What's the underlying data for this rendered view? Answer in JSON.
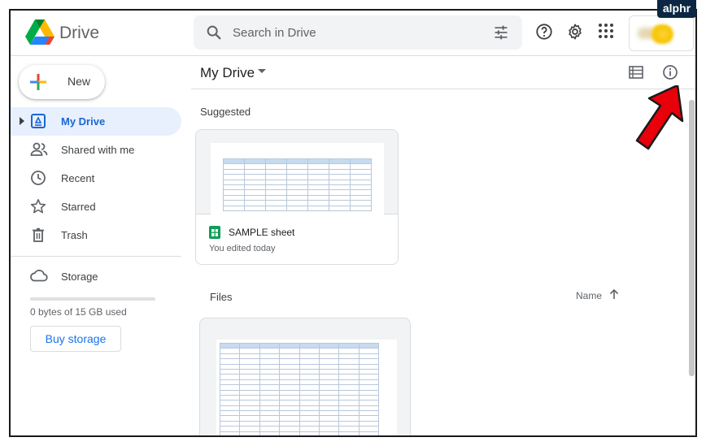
{
  "app": {
    "brand": "Drive",
    "watermark": "alphr"
  },
  "header": {
    "search_placeholder": "Search in Drive"
  },
  "sidebar": {
    "new_label": "New",
    "items": [
      {
        "label": "My Drive",
        "icon": "my-drive-icon",
        "active": true
      },
      {
        "label": "Shared with me",
        "icon": "shared-people-icon"
      },
      {
        "label": "Recent",
        "icon": "clock-icon"
      },
      {
        "label": "Starred",
        "icon": "star-icon"
      },
      {
        "label": "Trash",
        "icon": "trash-icon"
      }
    ],
    "storage": {
      "label": "Storage",
      "usage": "0 bytes of 15 GB used",
      "used_fraction": 0.0,
      "buy_label": "Buy storage"
    }
  },
  "main": {
    "title": "My Drive",
    "suggested_label": "Suggested",
    "files_label": "Files",
    "sort": {
      "label": "Name",
      "direction": "ascending"
    },
    "suggested_file": {
      "name": "SAMPLE sheet",
      "subtitle": "You edited today"
    }
  },
  "colors": {
    "accent": "#1a73e8",
    "active_bg": "#e8f0fe",
    "arrow": "#e8000b",
    "sheets_green": "#0f9d58"
  }
}
